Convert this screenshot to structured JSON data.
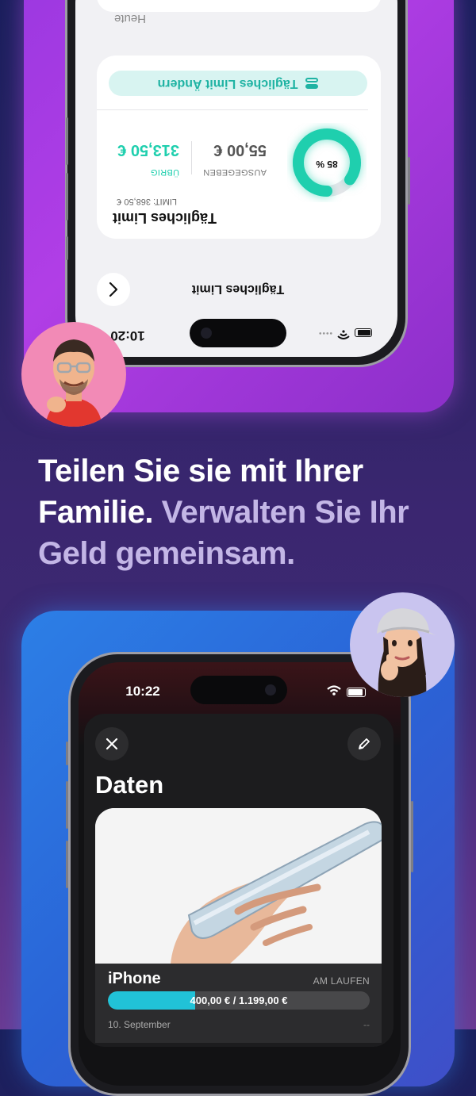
{
  "top_phone": {
    "status_time": "10:20",
    "nav_title": "Tägliches Limit",
    "section_label": "Heute",
    "change_limit_label": "Tägliches Limit Ändern",
    "spent_amount": "55,00 €",
    "spent_label": "AUSGEGEBEN",
    "remaining_amount": "313,50 €",
    "remaining_label": "ÜBRIG",
    "limit_text": "LIMIT: 368,50 €",
    "card_title": "Tägliches Limit",
    "ring_percent_text": "85 %",
    "ring_progress": 0.85,
    "accent_color": "#1fcfae"
  },
  "headline": {
    "part1": "Teilen Sie sie mit Ihrer Familie.",
    "part2": "Verwalten Sie Ihr Geld gemeinsam."
  },
  "bottom_phone": {
    "status_time": "10:22",
    "sheet_title": "Daten",
    "item_name": "iPhone",
    "item_status": "AM LAUFEN",
    "progress_text": "400,00 € / 1.199,00 €",
    "progress_value": 0.334,
    "date_text": "10. September",
    "date_trailing": "--",
    "accent_color": "#21c2d7"
  },
  "icons": {
    "close": "close-icon",
    "edit": "pencil-icon",
    "back": "chevron-left-icon",
    "toggle": "toggle-icon",
    "wifi": "wifi-icon",
    "battery": "battery-icon",
    "signal": "signal-icon"
  }
}
